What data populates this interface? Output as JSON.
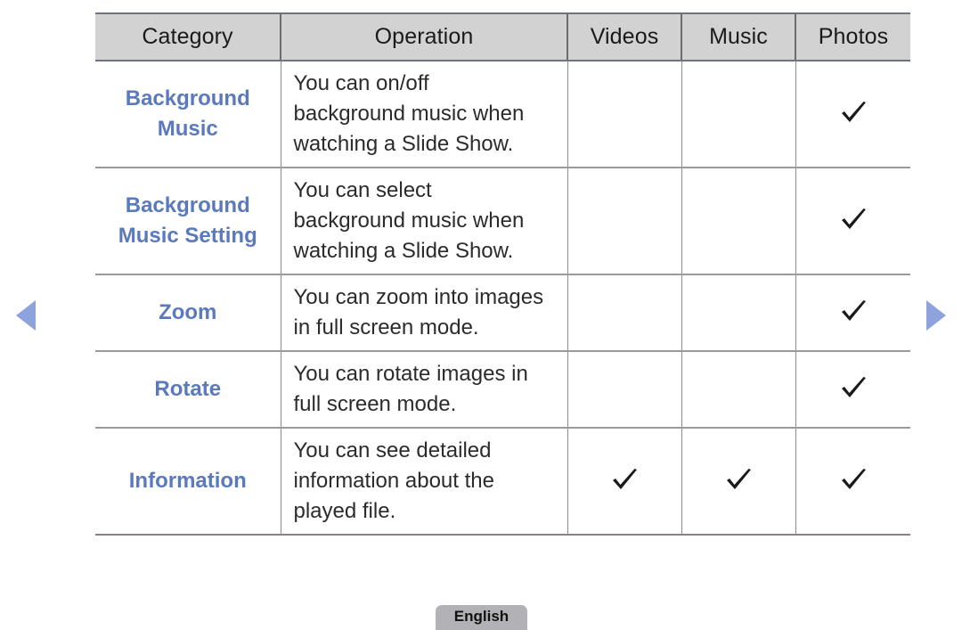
{
  "table": {
    "headers": [
      "Category",
      "Operation",
      "Videos",
      "Music",
      "Photos"
    ],
    "rows": [
      {
        "category": [
          "Background",
          "Music"
        ],
        "operation": [
          "You can on/off",
          "background music when",
          "watching a Slide Show."
        ],
        "videos": "",
        "music": "",
        "photos": "check"
      },
      {
        "category": [
          "Background",
          "Music Setting"
        ],
        "operation": [
          "You can select",
          "background music when",
          "watching a Slide Show."
        ],
        "videos": "",
        "music": "",
        "photos": "check"
      },
      {
        "category": [
          "Zoom"
        ],
        "operation": [
          "You can zoom into images",
          "in full screen mode."
        ],
        "videos": "",
        "music": "",
        "photos": "check"
      },
      {
        "category": [
          "Rotate"
        ],
        "operation": [
          "You can rotate images in",
          "full screen mode."
        ],
        "videos": "",
        "music": "",
        "photos": "check"
      },
      {
        "category": [
          "Information"
        ],
        "operation": [
          "You can see detailed",
          "information about the",
          "played file."
        ],
        "videos": "check",
        "music": "check",
        "photos": "check"
      }
    ]
  },
  "nav": {
    "prev_icon": "triangle-left-icon",
    "next_icon": "triangle-right-icon"
  },
  "footer": {
    "language_label": "English"
  },
  "colors": {
    "category_text": "#5b79bd",
    "header_background": "#d2d2d2",
    "arrow": "#8ea2dd",
    "language_button": "#b2b2b6",
    "checkmark": "#1a1a1a"
  }
}
